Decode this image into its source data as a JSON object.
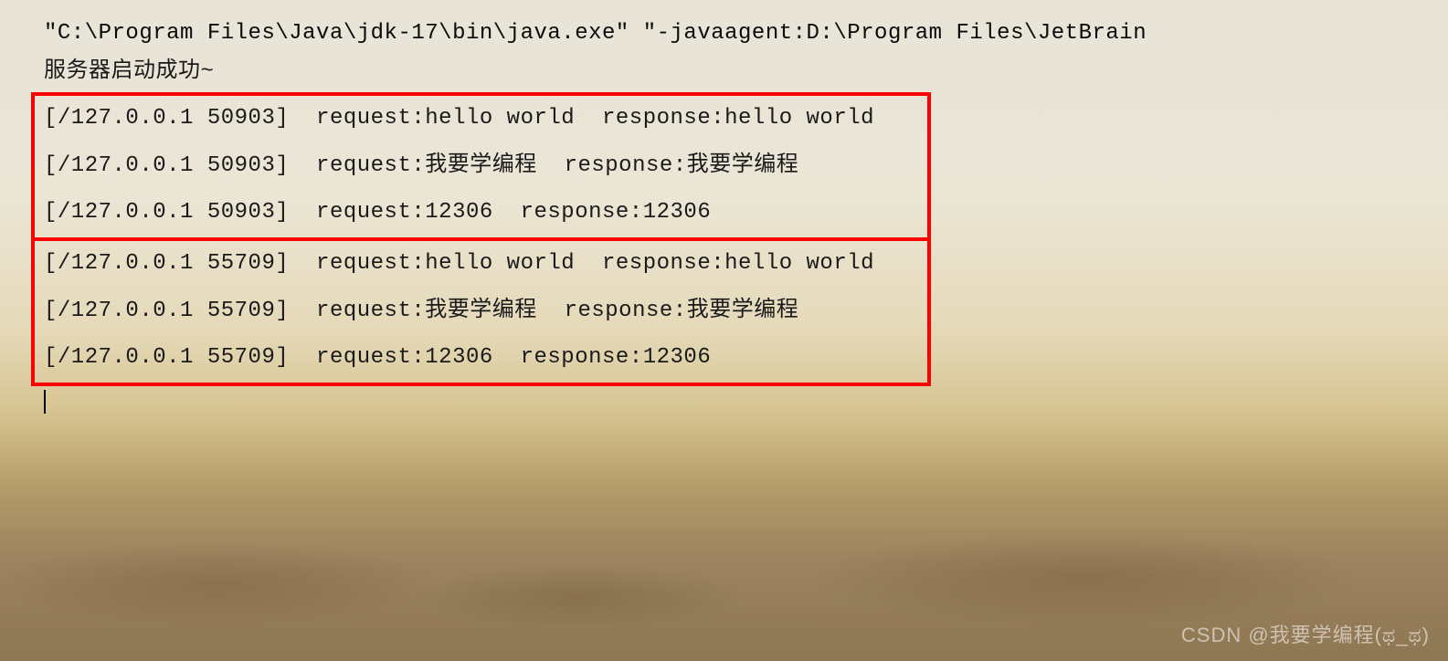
{
  "console": {
    "command_line": "\"C:\\Program Files\\Java\\jdk-17\\bin\\java.exe\" \"-javaagent:D:\\Program Files\\JetBrain",
    "startup_message": "服务器启动成功~",
    "groups": [
      {
        "lines": [
          "[/127.0.0.1 50903]  request:hello world  response:hello world",
          "[/127.0.0.1 50903]  request:我要学编程  response:我要学编程",
          "[/127.0.0.1 50903]  request:12306  response:12306"
        ]
      },
      {
        "lines": [
          "[/127.0.0.1 55709]  request:hello world  response:hello world",
          "[/127.0.0.1 55709]  request:我要学编程  response:我要学编程",
          "[/127.0.0.1 55709]  request:12306  response:12306"
        ]
      }
    ]
  },
  "watermark": "CSDN @我要学编程(ಥ_ಥ)"
}
